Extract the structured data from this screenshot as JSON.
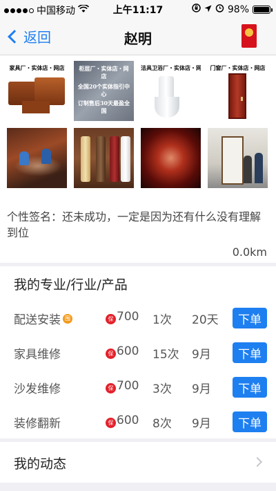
{
  "status_bar": {
    "carrier": "中国移动",
    "time": "上午11:17",
    "battery": "98%",
    "battery_level": 0.98
  },
  "nav": {
    "back_label": "返回",
    "title": "赵明"
  },
  "photos": [
    {
      "caption": "家具厂・实体店・网店"
    },
    {
      "caption": "柜层厂・实体店・网店",
      "lines": [
        "全国20个实体指引中心",
        "订制售后30天最盈全国"
      ]
    },
    {
      "caption": "洁具卫浴厂・实体店・网店"
    },
    {
      "caption": "门窗厂・实体店・网店"
    },
    {
      "caption": ""
    },
    {
      "caption": ""
    },
    {
      "caption": ""
    },
    {
      "caption": ""
    }
  ],
  "profile": {
    "signature": "个性签名：还未成功，一定是因为还有什么没有理解到位",
    "distance": "0.0km"
  },
  "services": {
    "title": "我的专业/行业/产品",
    "cert_badge": "围",
    "guarantee_badge": "保",
    "order_label": "下单",
    "rows": [
      {
        "name": "配送安装",
        "price": "700",
        "count": "1次",
        "time": "20天",
        "certified": true
      },
      {
        "name": "家具维修",
        "price": "600",
        "count": "15次",
        "time": "9月",
        "certified": false
      },
      {
        "name": "沙发维修",
        "price": "700",
        "count": "3次",
        "time": "9月",
        "certified": false
      },
      {
        "name": "装修翻新",
        "price": "600",
        "count": "8次",
        "time": "9月",
        "certified": false
      }
    ]
  },
  "feed": {
    "label": "我的动态"
  },
  "colors": {
    "accent": "#1e7ff0",
    "guarantee_red": "#e3202a",
    "cert_orange": "#f39a1e",
    "divider": "#efeff4"
  }
}
